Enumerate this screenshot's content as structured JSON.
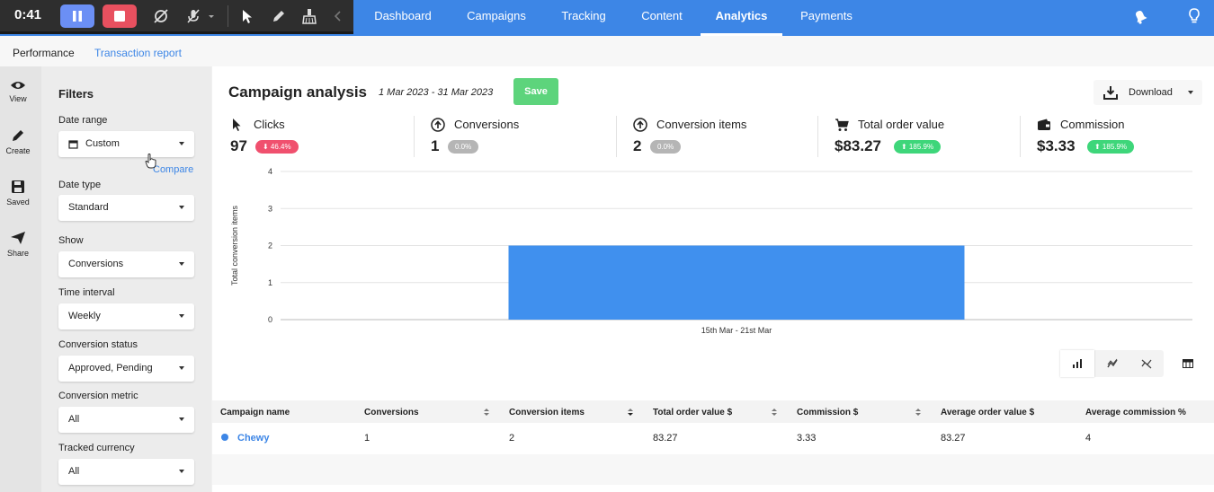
{
  "recorder": {
    "time": "0:41"
  },
  "nav": {
    "tabs": [
      {
        "label": "Dashboard"
      },
      {
        "label": "Campaigns"
      },
      {
        "label": "Tracking"
      },
      {
        "label": "Content"
      },
      {
        "label": "Analytics"
      },
      {
        "label": "Payments"
      }
    ],
    "active_tab": "Analytics"
  },
  "subtabs": [
    {
      "label": "Performance"
    },
    {
      "label": "Transaction report"
    }
  ],
  "rail": [
    {
      "label": "View",
      "icon": "eye-icon"
    },
    {
      "label": "Create",
      "icon": "pencil-icon"
    },
    {
      "label": "Saved",
      "icon": "save-icon"
    },
    {
      "label": "Share",
      "icon": "send-icon"
    }
  ],
  "filters": {
    "title": "Filters",
    "compare": "Compare",
    "fields": [
      {
        "label": "Date range",
        "value": "Custom"
      },
      {
        "label": "Date type",
        "value": "Standard"
      },
      {
        "label": "Show",
        "value": "Conversions"
      },
      {
        "label": "Time interval",
        "value": "Weekly"
      },
      {
        "label": "Conversion status",
        "value": "Approved, Pending"
      },
      {
        "label": "Conversion metric",
        "value": "All"
      },
      {
        "label": "Tracked currency",
        "value": "All"
      }
    ]
  },
  "main": {
    "title": "Campaign analysis",
    "date_range": "1 Mar 2023 - 31 Mar 2023",
    "save_label": "Save",
    "download_label": "Download"
  },
  "metrics": [
    {
      "label": "Clicks",
      "value": "97",
      "change": "⬇ 46.4%",
      "trend": "down",
      "color": "#f0506e",
      "icon": "cursor-icon"
    },
    {
      "label": "Conversions",
      "value": "1",
      "change": "0.0%",
      "trend": "flat",
      "color": "#b5b5b5",
      "icon": "arrow-up-circle-icon"
    },
    {
      "label": "Conversion items",
      "value": "2",
      "change": "0.0%",
      "trend": "flat",
      "color": "#b5b5b5",
      "icon": "arrow-up-circle-icon"
    },
    {
      "label": "Total order value",
      "value": "$83.27",
      "change": "⬆ 185.9%",
      "trend": "up",
      "color": "#3ed67a",
      "icon": "cart-icon"
    },
    {
      "label": "Commission",
      "value": "$3.33",
      "change": "⬆ 185.9%",
      "trend": "up",
      "color": "#3ed67a",
      "icon": "wallet-icon"
    }
  ],
  "chart_data": {
    "type": "bar",
    "categories": [
      "15th Mar - 21st Mar"
    ],
    "values": [
      2
    ],
    "ylabel": "Total conversion items",
    "xlabel": "",
    "ylim": [
      0,
      4
    ],
    "yticks": [
      0,
      1,
      2,
      3,
      4
    ],
    "grid": true,
    "bar_color": "#4090ee"
  },
  "table": {
    "columns": [
      "Campaign name",
      "Conversions",
      "Conversion items",
      "Total order value $",
      "Commission $",
      "Average order value $",
      "Average commission %"
    ],
    "rows": [
      {
        "campaign": "Chewy",
        "conversions": "1",
        "conversion_items": "2",
        "total_order_value": "83.27",
        "commission": "3.33",
        "average_order_value": "83.27",
        "average_commission": "4"
      }
    ]
  },
  "colors": {
    "primary": "#3d86e6",
    "save": "#5dd47c",
    "series_dot": "#3d86e6"
  }
}
